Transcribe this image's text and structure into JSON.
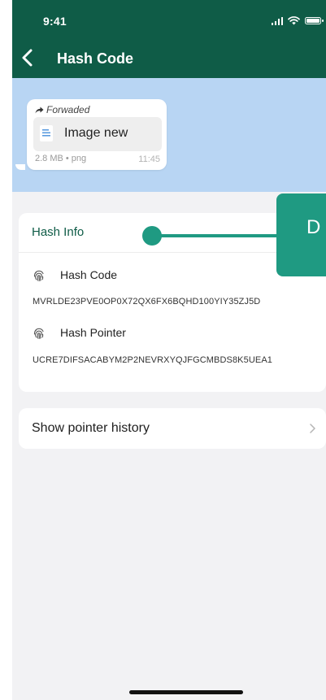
{
  "status_bar": {
    "time": "9:41"
  },
  "header": {
    "title": "Hash Code"
  },
  "message": {
    "forwarded_label": "Forwaded",
    "file_name": "Image new",
    "meta": "2.8 MB • png",
    "time": "11:45"
  },
  "hash_info": {
    "title": "Hash Info",
    "hash_code_label": "Hash Code",
    "hash_code_value": "MVRLDE23PVE0OP0X72QX6FX6BQHD100YIY35ZJ5D",
    "hash_pointer_label": "Hash Pointer",
    "hash_pointer_value": "UCRE7DIFSACABYM2P2NEVRXYQJFGCMBDS8K5UEA1"
  },
  "history": {
    "label": "Show pointer history"
  },
  "annotation": {
    "label": "D"
  },
  "colors": {
    "header_bg": "#0f5c47",
    "preview_bg": "#b8d5f3",
    "accent": "#1f9a82",
    "screen_bg": "#f2f2f4"
  },
  "icons": [
    "back-arrow-icon",
    "signal-icon",
    "wifi-icon",
    "battery-icon",
    "forward-icon",
    "file-icon",
    "fingerprint-icon",
    "chevron-right-icon"
  ]
}
